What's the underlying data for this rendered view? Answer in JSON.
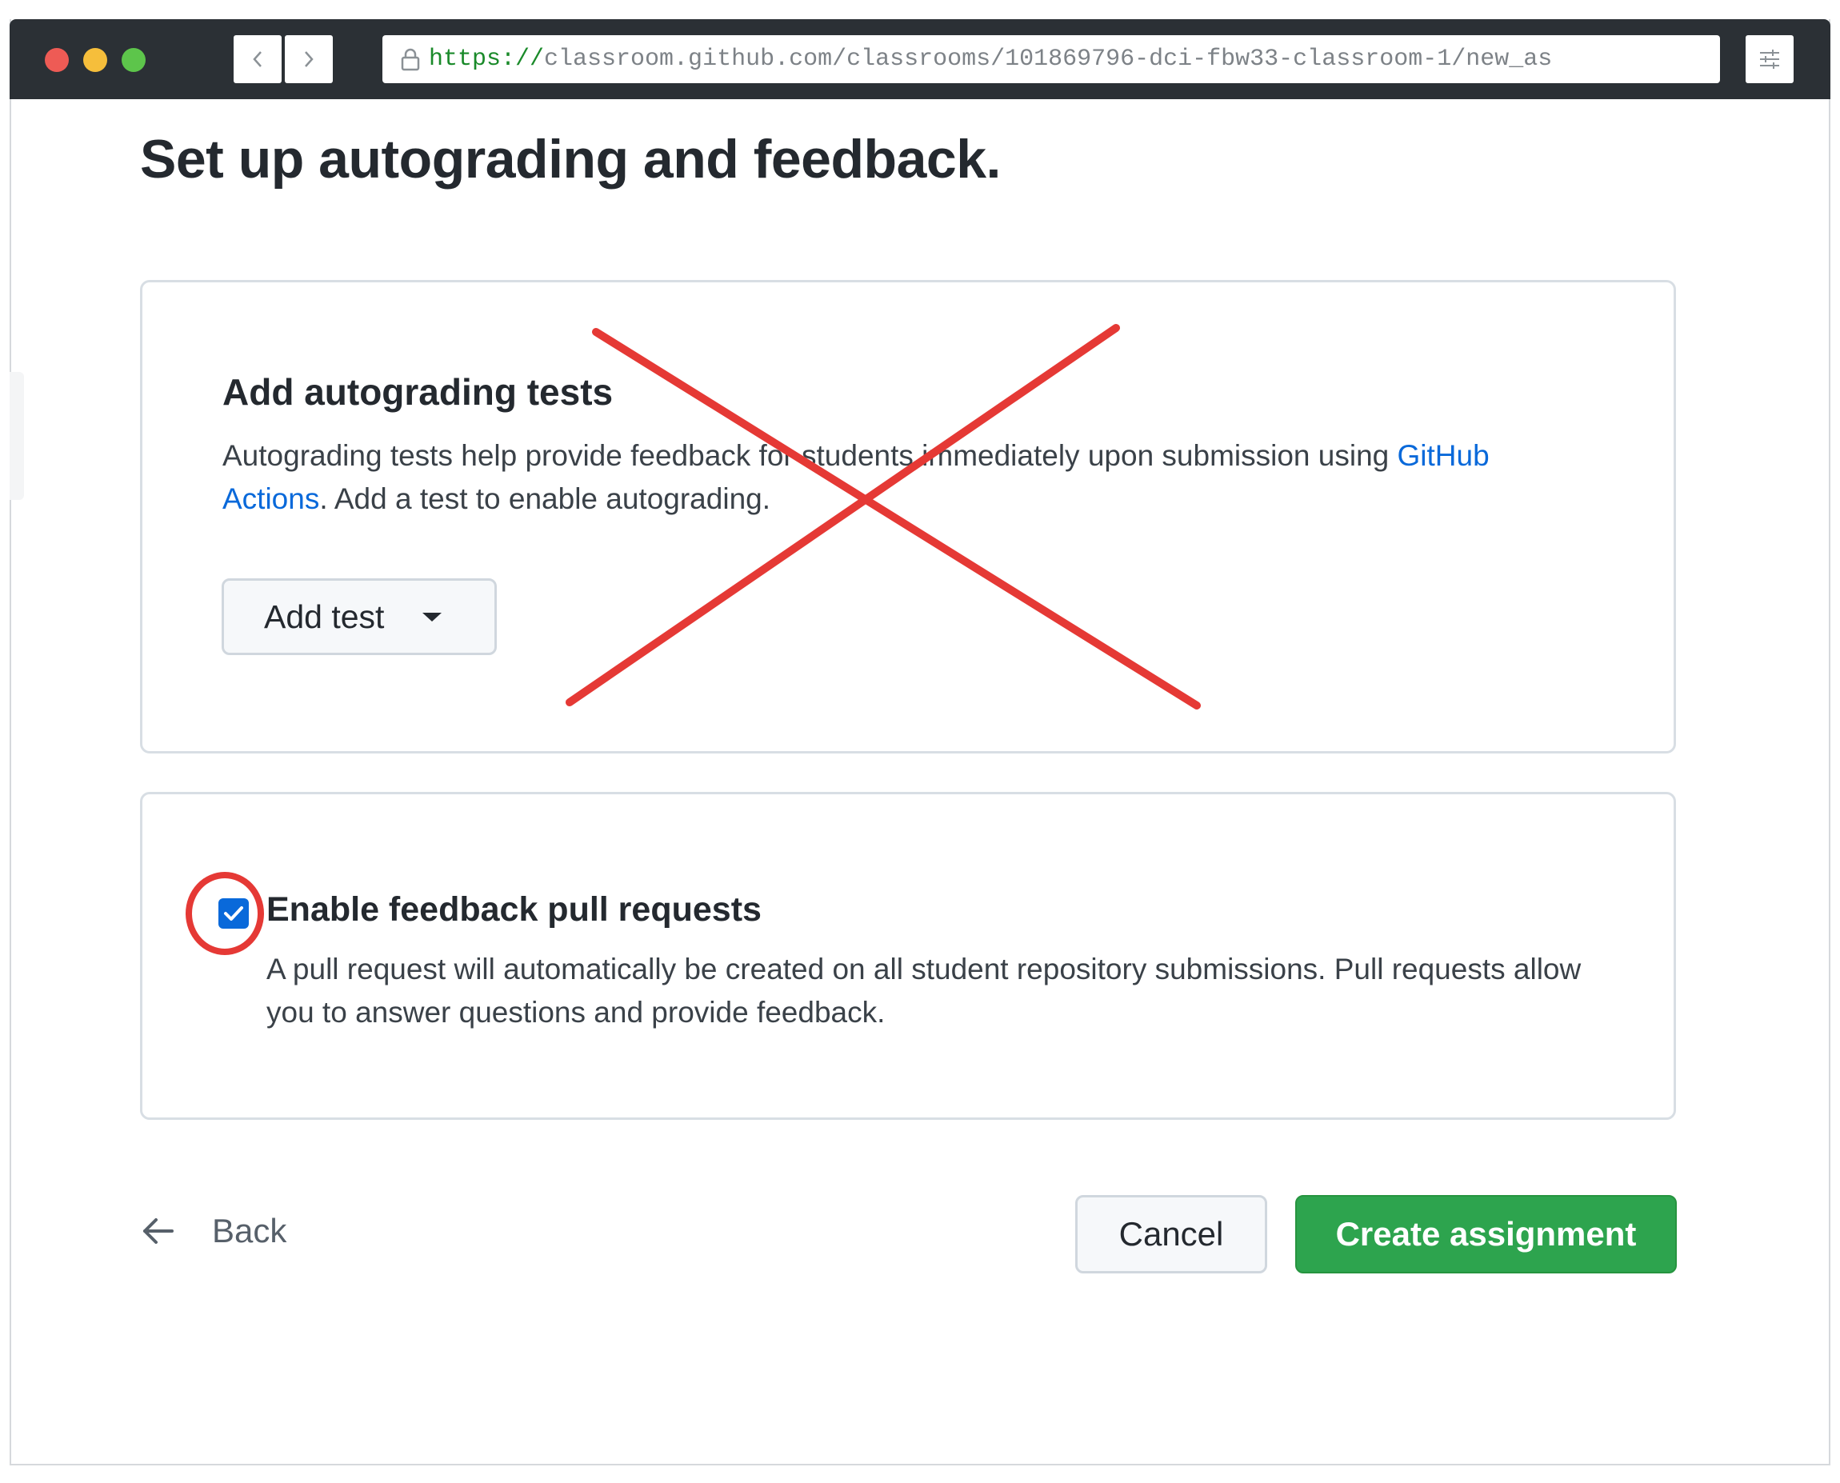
{
  "browser": {
    "url_scheme": "https://",
    "url_rest": "classroom.github.com/classrooms/101869796-dci-fbw33-classroom-1/new_as",
    "traffic_lights": {
      "close": "#ee5b55",
      "minimize": "#f6be3b",
      "maximize": "#5dc54b"
    }
  },
  "page": {
    "title": "Set up autograding and feedback."
  },
  "autograding": {
    "heading": "Add autograding tests",
    "description_before_link": "Autograding tests help provide feedback for students immediately upon submission using ",
    "link_text": "GitHub Actions",
    "description_after_link": ". Add a test to enable autograding.",
    "add_test_label": "Add test",
    "crossed_out": true,
    "annotation_color": "#e53935"
  },
  "feedback": {
    "checkbox_checked": true,
    "label": "Enable feedback pull requests",
    "description": "A pull request will automatically be created on all student repository submissions. Pull requests allow you to answer questions and provide feedback.",
    "highlighted": true
  },
  "actions": {
    "back_label": "Back",
    "cancel_label": "Cancel",
    "create_label": "Create assignment",
    "primary_color": "#2da44e",
    "link_color": "#0969da"
  }
}
